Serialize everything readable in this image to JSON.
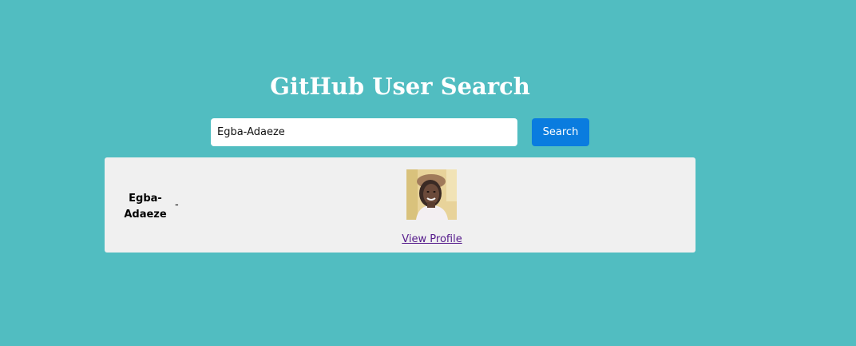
{
  "header": {
    "title": "GitHub User Search"
  },
  "search": {
    "value": "Egba-Adaeze",
    "button_label": "Search"
  },
  "result": {
    "username": "Egba-Adaeze",
    "bio": "-",
    "link_label": "View Profile"
  },
  "colors": {
    "background": "#51bdc1",
    "button": "#0a7cdf",
    "card": "#f0f0f0",
    "visited_link": "#551a8b"
  }
}
